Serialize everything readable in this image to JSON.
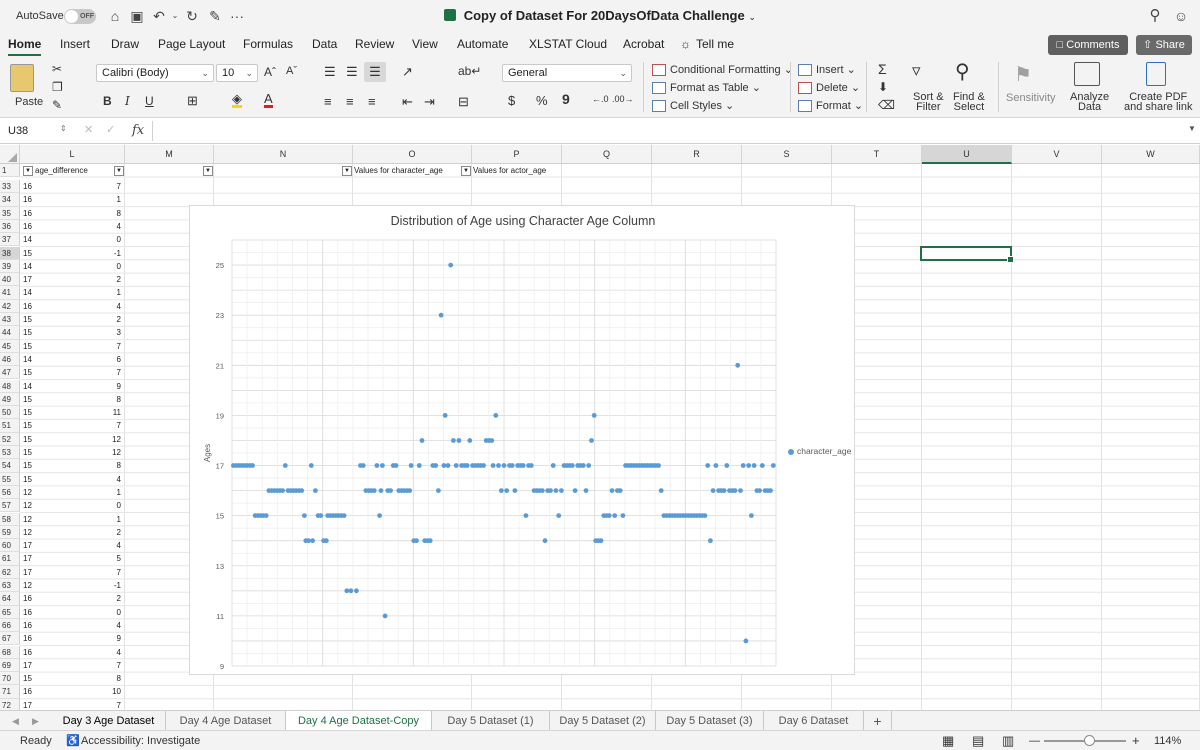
{
  "titlebar": {
    "autosave_label": "AutoSave",
    "autosave_state": "OFF",
    "document_title": "Copy of Dataset For 20DaysOfData Challenge",
    "more": "···"
  },
  "ribbon_tabs": [
    {
      "label": "Home",
      "active": true
    },
    {
      "label": "Insert"
    },
    {
      "label": "Draw"
    },
    {
      "label": "Page Layout"
    },
    {
      "label": "Formulas"
    },
    {
      "label": "Data"
    },
    {
      "label": "Review"
    },
    {
      "label": "View"
    },
    {
      "label": "Automate"
    },
    {
      "label": "XLSTAT Cloud"
    },
    {
      "label": "Acrobat"
    },
    {
      "label": "Tell me"
    }
  ],
  "comments_label": "Comments",
  "share_label": "Share",
  "ribbon": {
    "paste": "Paste",
    "font_name": "Calibri (Body)",
    "font_size": "10",
    "number_format": "General",
    "conditional_formatting": "Conditional Formatting",
    "format_as_table": "Format as Table",
    "cell_styles": "Cell Styles",
    "insert": "Insert",
    "delete": "Delete",
    "format": "Format",
    "sort_filter_1": "Sort &",
    "sort_filter_2": "Filter",
    "find_select_1": "Find &",
    "find_select_2": "Select",
    "sensitivity": "Sensitivity",
    "analyze_1": "Analyze",
    "analyze_2": "Data",
    "pdf_1": "Create PDF",
    "pdf_2": "and share link",
    "bold": "B",
    "italic": "I",
    "underline": "U",
    "currency": "$",
    "percent": "%",
    "comma": "9"
  },
  "formula_bar": {
    "name_box": "U38",
    "fx": "fx",
    "value": ""
  },
  "columns": [
    {
      "label": "L",
      "w": 105
    },
    {
      "label": "M",
      "w": 89
    },
    {
      "label": "N",
      "w": 139
    },
    {
      "label": "O",
      "w": 119
    },
    {
      "label": "P",
      "w": 90
    },
    {
      "label": "Q",
      "w": 90
    },
    {
      "label": "R",
      "w": 90
    },
    {
      "label": "S",
      "w": 90
    },
    {
      "label": "T",
      "w": 90
    },
    {
      "label": "U",
      "w": 90,
      "selected": true
    },
    {
      "label": "V",
      "w": 90
    },
    {
      "label": "W",
      "w": 98
    }
  ],
  "header_row": {
    "row": "1",
    "age_difference": "age_difference",
    "values_character_age": "Values for character_age",
    "values_actor_age": "Values for actor_age"
  },
  "rows": [
    {
      "n": "33",
      "a": "16",
      "b": "7"
    },
    {
      "n": "34",
      "a": "16",
      "b": "1"
    },
    {
      "n": "35",
      "a": "16",
      "b": "8"
    },
    {
      "n": "36",
      "a": "16",
      "b": "4"
    },
    {
      "n": "37",
      "a": "14",
      "b": "0"
    },
    {
      "n": "38",
      "a": "15",
      "b": "-1",
      "selected": true
    },
    {
      "n": "39",
      "a": "14",
      "b": "0"
    },
    {
      "n": "40",
      "a": "17",
      "b": "2"
    },
    {
      "n": "41",
      "a": "14",
      "b": "1"
    },
    {
      "n": "42",
      "a": "16",
      "b": "4"
    },
    {
      "n": "43",
      "a": "15",
      "b": "2"
    },
    {
      "n": "44",
      "a": "15",
      "b": "3"
    },
    {
      "n": "45",
      "a": "15",
      "b": "7"
    },
    {
      "n": "46",
      "a": "14",
      "b": "6"
    },
    {
      "n": "47",
      "a": "15",
      "b": "7"
    },
    {
      "n": "48",
      "a": "14",
      "b": "9"
    },
    {
      "n": "49",
      "a": "15",
      "b": "8"
    },
    {
      "n": "50",
      "a": "15",
      "b": "11"
    },
    {
      "n": "51",
      "a": "15",
      "b": "7"
    },
    {
      "n": "52",
      "a": "15",
      "b": "12"
    },
    {
      "n": "53",
      "a": "15",
      "b": "12"
    },
    {
      "n": "54",
      "a": "15",
      "b": "8"
    },
    {
      "n": "55",
      "a": "15",
      "b": "4"
    },
    {
      "n": "56",
      "a": "12",
      "b": "1"
    },
    {
      "n": "57",
      "a": "12",
      "b": "0"
    },
    {
      "n": "58",
      "a": "12",
      "b": "1"
    },
    {
      "n": "59",
      "a": "12",
      "b": "2"
    },
    {
      "n": "60",
      "a": "17",
      "b": "4"
    },
    {
      "n": "61",
      "a": "17",
      "b": "5"
    },
    {
      "n": "62",
      "a": "17",
      "b": "7"
    },
    {
      "n": "63",
      "a": "12",
      "b": "-1"
    },
    {
      "n": "64",
      "a": "16",
      "b": "2"
    },
    {
      "n": "65",
      "a": "16",
      "b": "0"
    },
    {
      "n": "66",
      "a": "16",
      "b": "4"
    },
    {
      "n": "67",
      "a": "16",
      "b": "9"
    },
    {
      "n": "68",
      "a": "16",
      "b": "4"
    },
    {
      "n": "69",
      "a": "17",
      "b": "7"
    },
    {
      "n": "70",
      "a": "15",
      "b": "8"
    },
    {
      "n": "71",
      "a": "16",
      "b": "10"
    },
    {
      "n": "72",
      "a": "17",
      "b": "7"
    }
  ],
  "chart_data": {
    "type": "scatter",
    "title": "Distribution of Age using Character Age Column",
    "ylabel": "Ages",
    "xlabel": "",
    "ylim": [
      9,
      26
    ],
    "yticks": [
      9,
      11,
      13,
      15,
      17,
      19,
      21,
      23,
      25
    ],
    "xlim": [
      0,
      250
    ],
    "grid": true,
    "legend_position": "right",
    "series_color": "#5b9bd5",
    "series": [
      {
        "name": "character_age",
        "points": [
          [
            1,
            17
          ],
          [
            3,
            17
          ],
          [
            5,
            17
          ],
          [
            7,
            17
          ],
          [
            9,
            17
          ],
          [
            11,
            17
          ],
          [
            13,
            17
          ],
          [
            15,
            17
          ],
          [
            17,
            15
          ],
          [
            19,
            15
          ],
          [
            21,
            15
          ],
          [
            23,
            15
          ],
          [
            25,
            15
          ],
          [
            27,
            16
          ],
          [
            29,
            16
          ],
          [
            31,
            16
          ],
          [
            33,
            16
          ],
          [
            35,
            16
          ],
          [
            37,
            16
          ],
          [
            39,
            17
          ],
          [
            41,
            16
          ],
          [
            43,
            16
          ],
          [
            45,
            16
          ],
          [
            47,
            16
          ],
          [
            49,
            16
          ],
          [
            51,
            16
          ],
          [
            53,
            15
          ],
          [
            54,
            14
          ],
          [
            56,
            14
          ],
          [
            58,
            17
          ],
          [
            59,
            14
          ],
          [
            61,
            16
          ],
          [
            63,
            15
          ],
          [
            65,
            15
          ],
          [
            67,
            14
          ],
          [
            69,
            14
          ],
          [
            70,
            15
          ],
          [
            72,
            15
          ],
          [
            74,
            15
          ],
          [
            76,
            15
          ],
          [
            78,
            15
          ],
          [
            80,
            15
          ],
          [
            82,
            15
          ],
          [
            84,
            12
          ],
          [
            87,
            12
          ],
          [
            91,
            12
          ],
          [
            94,
            17
          ],
          [
            96,
            17
          ],
          [
            98,
            16
          ],
          [
            100,
            16
          ],
          [
            102,
            16
          ],
          [
            104,
            16
          ],
          [
            106,
            17
          ],
          [
            108,
            15
          ],
          [
            109,
            16
          ],
          [
            110,
            17
          ],
          [
            112,
            11
          ],
          [
            114,
            16
          ],
          [
            116,
            16
          ],
          [
            118,
            17
          ],
          [
            120,
            17
          ],
          [
            122,
            16
          ],
          [
            124,
            16
          ],
          [
            126,
            16
          ],
          [
            128,
            16
          ],
          [
            130,
            16
          ],
          [
            131,
            17
          ],
          [
            133,
            14
          ],
          [
            135,
            14
          ],
          [
            137,
            17
          ],
          [
            139,
            18
          ],
          [
            141,
            14
          ],
          [
            143,
            14
          ],
          [
            145,
            14
          ],
          [
            147,
            17
          ],
          [
            149,
            17
          ],
          [
            151,
            16
          ],
          [
            153,
            23
          ],
          [
            155,
            17
          ],
          [
            156,
            19
          ],
          [
            158,
            17
          ],
          [
            160,
            25
          ],
          [
            162,
            18
          ],
          [
            164,
            17
          ],
          [
            166,
            18
          ],
          [
            168,
            17
          ],
          [
            170,
            17
          ],
          [
            172,
            17
          ],
          [
            174,
            18
          ],
          [
            176,
            17
          ],
          [
            178,
            17
          ],
          [
            180,
            17
          ],
          [
            182,
            17
          ],
          [
            184,
            17
          ],
          [
            186,
            18
          ],
          [
            188,
            18
          ],
          [
            190,
            18
          ],
          [
            191,
            17
          ],
          [
            193,
            19
          ],
          [
            195,
            17
          ],
          [
            197,
            16
          ],
          [
            199,
            17
          ],
          [
            201,
            16
          ],
          [
            203,
            17
          ],
          [
            205,
            17
          ],
          [
            207,
            16
          ],
          [
            209,
            17
          ],
          [
            211,
            17
          ],
          [
            213,
            17
          ],
          [
            215,
            15
          ],
          [
            217,
            17
          ],
          [
            219,
            17
          ],
          [
            221,
            16
          ],
          [
            223,
            16
          ],
          [
            225,
            16
          ],
          [
            227,
            16
          ],
          [
            229,
            14
          ],
          [
            231,
            16
          ],
          [
            233,
            16
          ],
          [
            235,
            17
          ],
          [
            237,
            16
          ],
          [
            239,
            15
          ],
          [
            241,
            16
          ],
          [
            243,
            17
          ],
          [
            245,
            17
          ],
          [
            247,
            17
          ],
          [
            249,
            17
          ],
          [
            251,
            16
          ],
          [
            253,
            17
          ],
          [
            255,
            17
          ],
          [
            257,
            17
          ],
          [
            259,
            16
          ],
          [
            261,
            17
          ],
          [
            263,
            18
          ],
          [
            265,
            19
          ],
          [
            266,
            14
          ],
          [
            268,
            14
          ],
          [
            270,
            14
          ],
          [
            272,
            15
          ],
          [
            274,
            15
          ],
          [
            276,
            15
          ],
          [
            278,
            16
          ],
          [
            280,
            15
          ],
          [
            282,
            16
          ],
          [
            284,
            16
          ],
          [
            286,
            15
          ],
          [
            288,
            17
          ],
          [
            290,
            17
          ],
          [
            292,
            17
          ],
          [
            294,
            17
          ],
          [
            296,
            17
          ],
          [
            298,
            17
          ],
          [
            300,
            17
          ],
          [
            302,
            17
          ],
          [
            304,
            17
          ],
          [
            306,
            17
          ],
          [
            308,
            17
          ],
          [
            310,
            17
          ],
          [
            312,
            17
          ],
          [
            314,
            16
          ],
          [
            316,
            15
          ],
          [
            318,
            15
          ],
          [
            320,
            15
          ],
          [
            322,
            15
          ],
          [
            324,
            15
          ],
          [
            326,
            15
          ],
          [
            328,
            15
          ],
          [
            330,
            15
          ],
          [
            332,
            15
          ],
          [
            334,
            15
          ],
          [
            336,
            15
          ],
          [
            338,
            15
          ],
          [
            340,
            15
          ],
          [
            342,
            15
          ],
          [
            344,
            15
          ],
          [
            346,
            15
          ],
          [
            348,
            17
          ],
          [
            350,
            14
          ],
          [
            352,
            16
          ],
          [
            354,
            17
          ],
          [
            356,
            16
          ],
          [
            358,
            16
          ],
          [
            360,
            16
          ],
          [
            362,
            17
          ],
          [
            364,
            16
          ],
          [
            366,
            16
          ],
          [
            368,
            16
          ],
          [
            370,
            21
          ],
          [
            372,
            16
          ],
          [
            374,
            17
          ],
          [
            376,
            10
          ],
          [
            378,
            17
          ],
          [
            380,
            15
          ],
          [
            382,
            17
          ],
          [
            384,
            16
          ],
          [
            386,
            16
          ],
          [
            388,
            17
          ],
          [
            390,
            16
          ],
          [
            392,
            16
          ],
          [
            394,
            16
          ],
          [
            396,
            17
          ]
        ]
      }
    ]
  },
  "sheet_tabs": [
    {
      "label": "Day 3 Age Dataset",
      "bold": true
    },
    {
      "label": "Day 4 Age Dataset"
    },
    {
      "label": "Day 4 Age Dataset-Copy",
      "active": true
    },
    {
      "label": "Day 5 Dataset (1)"
    },
    {
      "label": "Day 5 Dataset (2)"
    },
    {
      "label": "Day 5 Dataset (3)"
    },
    {
      "label": "Day 6 Dataset"
    }
  ],
  "add_sheet": "+",
  "statusbar": {
    "ready": "Ready",
    "accessibility": "Accessibility: Investigate",
    "zoom": "114%",
    "zoom_fraction": 0.55,
    "minus": "—",
    "plus": "+"
  }
}
